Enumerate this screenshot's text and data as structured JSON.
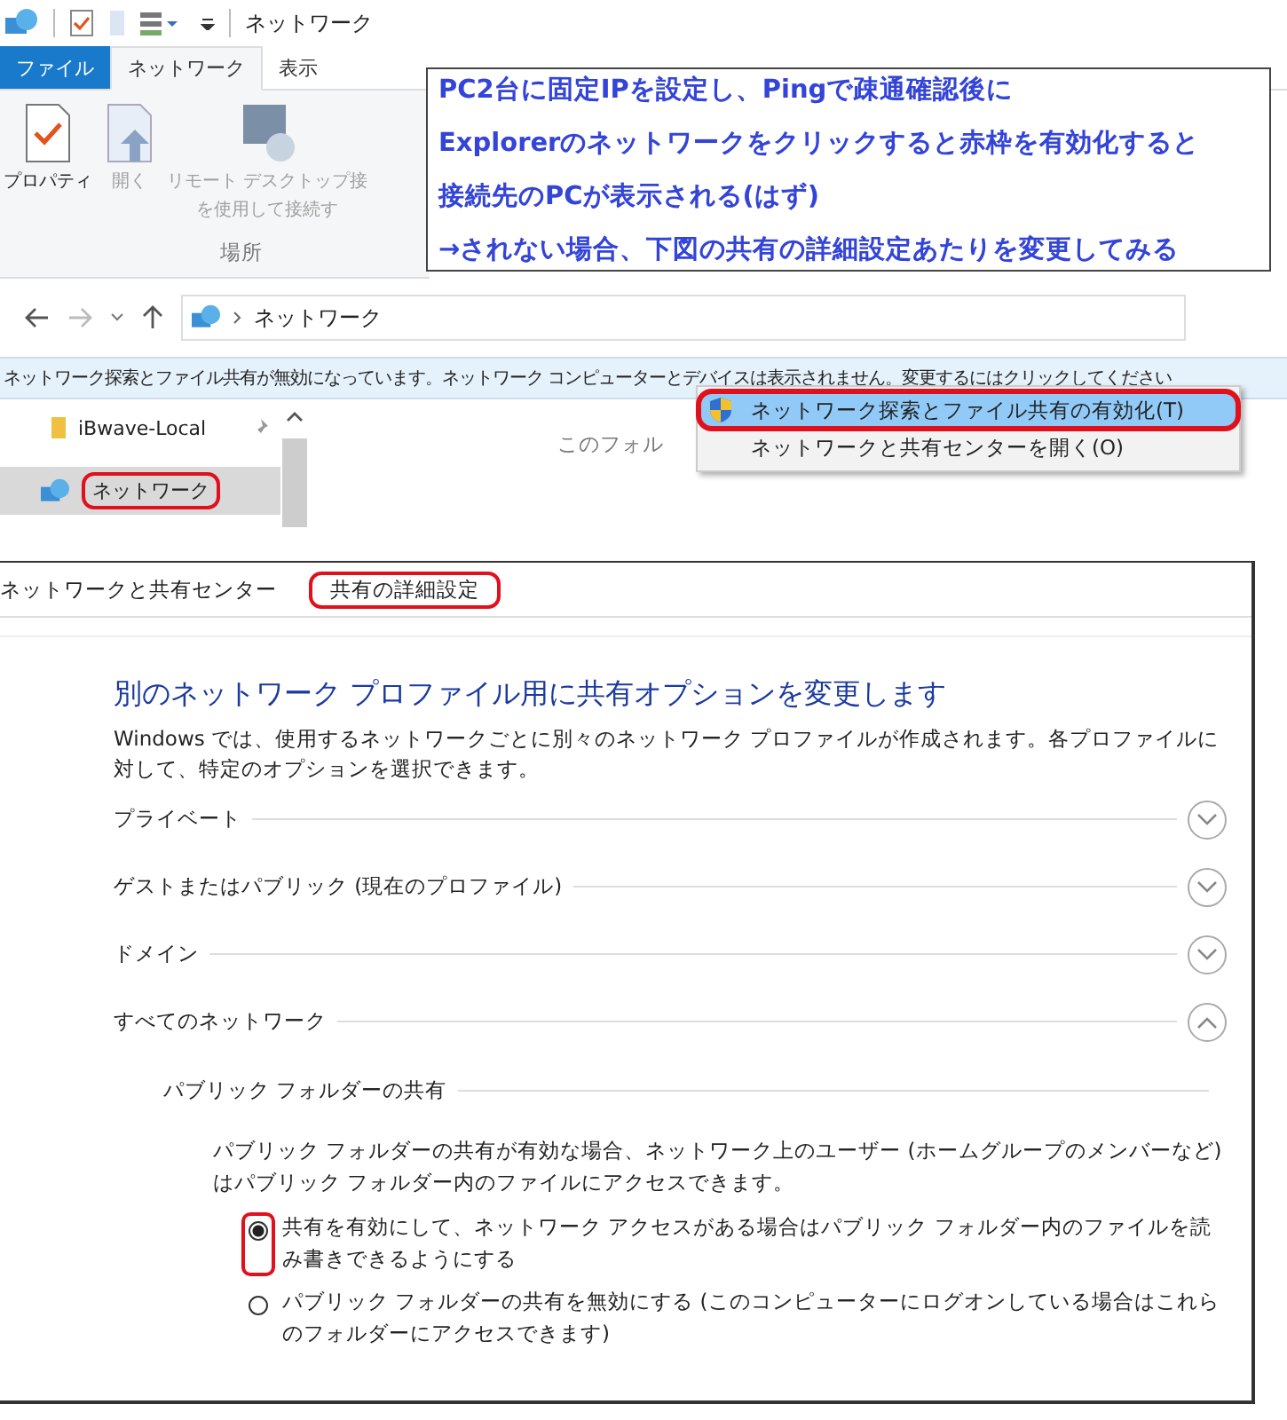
{
  "explorer": {
    "title": "ネットワーク",
    "ribbon_tabs": [
      {
        "label": "ファイル",
        "kind": "file",
        "selected": false
      },
      {
        "label": "ネットワーク",
        "kind": "tab",
        "selected": true
      },
      {
        "label": "表示",
        "kind": "tab",
        "selected": false
      }
    ],
    "ribbon_buttons": [
      {
        "lines": [
          "プロパティ"
        ],
        "kind": "properties",
        "disabled": false
      },
      {
        "lines": [
          "開く"
        ],
        "kind": "open",
        "disabled": true
      },
      {
        "lines": [
          "リモート デスクトップ接",
          "を使用して接続す"
        ],
        "kind": "remote",
        "disabled": true
      }
    ],
    "ribbon_group": "場所",
    "address": "ネットワーク",
    "info_bar": "ネットワーク探索とファイル共有が無効になっています。ネットワーク コンピューターとデバイスは表示されません。変更するにはクリックしてください",
    "nav_items": [
      {
        "label": "iBwave-Local",
        "kind": "folder",
        "pinned": true,
        "selected": false,
        "circled": false
      },
      {
        "label": "ネットワーク",
        "kind": "network",
        "pinned": false,
        "selected": true,
        "circled": true
      }
    ],
    "content_text": "このフォル",
    "context_menu": [
      {
        "label": "ネットワーク探索とファイル共有の有効化(T)",
        "shield": true,
        "selected": true,
        "circled": true
      },
      {
        "label": "ネットワークと共有センターを開く(O)",
        "shield": false,
        "selected": false,
        "circled": false
      }
    ]
  },
  "annotation": {
    "lines": [
      "PC2台に固定IPを設定し、Pingで疎通確認後に",
      "Explorerのネットワークをクリックすると赤枠を有効化すると",
      "接続先のPCが表示される(はず)",
      "→されない場合、下図の共有の詳細設定あたりを変更してみる"
    ]
  },
  "settings": {
    "breadcrumb": [
      {
        "label": "ネットワークと共有センター",
        "circled": false
      },
      {
        "label": "共有の詳細設定",
        "circled": true
      }
    ],
    "heading": "別のネットワーク プロファイル用に共有オプションを変更します",
    "description": "Windows では、使用するネットワークごとに別々のネットワーク プロファイルが作成されます。各プロファイルに対して、特定のオプションを選択できます。",
    "sections": [
      {
        "label": "プライベート",
        "expanded": false
      },
      {
        "label": "ゲストまたはパブリック (現在のプロファイル)",
        "expanded": false
      },
      {
        "label": "ドメイン",
        "expanded": false
      },
      {
        "label": "すべてのネットワーク",
        "expanded": true
      }
    ],
    "subsection": {
      "title": "パブリック フォルダーの共有",
      "description": "パブリック フォルダーの共有が有効な場合、ネットワーク上のユーザー (ホームグループのメンバーなど) はパブリック フォルダー内のファイルにアクセスできます。",
      "options": [
        {
          "label": "共有を有効にして、ネットワーク アクセスがある場合はパブリック フォルダー内のファイルを読み書きできるようにする",
          "selected": true,
          "circled": true
        },
        {
          "label": "パブリック フォルダーの共有を無効にする (このコンピューターにログオンしている場合はこれらのフォルダーにアクセスできます)",
          "selected": false,
          "circled": false
        }
      ]
    }
  }
}
